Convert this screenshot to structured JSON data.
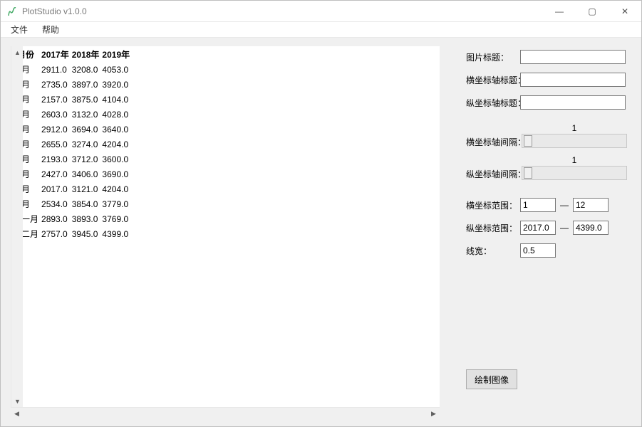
{
  "window": {
    "title": "PlotStudio v1.0.0",
    "buttons": {
      "min": "—",
      "max": "▢",
      "close": "✕"
    }
  },
  "menu": {
    "file": "文件",
    "help": "帮助"
  },
  "table": {
    "headers": [
      "月份",
      "2017年",
      "2018年",
      "2019年"
    ],
    "rows": [
      [
        "一月",
        "2911.0",
        "3208.0",
        "4053.0"
      ],
      [
        "二月",
        "2735.0",
        "3897.0",
        "3920.0"
      ],
      [
        "三月",
        "2157.0",
        "3875.0",
        "4104.0"
      ],
      [
        "四月",
        "2603.0",
        "3132.0",
        "4028.0"
      ],
      [
        "五月",
        "2912.0",
        "3694.0",
        "3640.0"
      ],
      [
        "六月",
        "2655.0",
        "3274.0",
        "4204.0"
      ],
      [
        "七月",
        "2193.0",
        "3712.0",
        "3600.0"
      ],
      [
        "八月",
        "2427.0",
        "3406.0",
        "3690.0"
      ],
      [
        "九月",
        "2017.0",
        "3121.0",
        "4204.0"
      ],
      [
        "十月",
        "2534.0",
        "3854.0",
        "3779.0"
      ],
      [
        "十一月",
        "2893.0",
        "3893.0",
        "3769.0"
      ],
      [
        "十二月",
        "2757.0",
        "3945.0",
        "4399.0"
      ]
    ]
  },
  "side": {
    "title_label": "图片标题：",
    "title_value": "",
    "xlabel_label": "横坐标轴标题：",
    "xlabel_value": "",
    "ylabel_label": "纵坐标轴标题：",
    "ylabel_value": "",
    "xinterval_label": "横坐标轴间隔：",
    "xinterval_value": "1",
    "yinterval_label": "纵坐标轴间隔：",
    "yinterval_value": "1",
    "xrange_label": "横坐标范围：",
    "xrange_min": "1",
    "xrange_max": "12",
    "yrange_label": "纵坐标范围：",
    "yrange_min": "2017.0",
    "yrange_max": "4399.0",
    "linewidth_label": "线宽：",
    "linewidth_value": "0.5",
    "range_dash": "—",
    "draw_button": "绘制图像"
  },
  "scroll": {
    "up": "▲",
    "down": "▼",
    "left": "◀",
    "right": "▶"
  }
}
